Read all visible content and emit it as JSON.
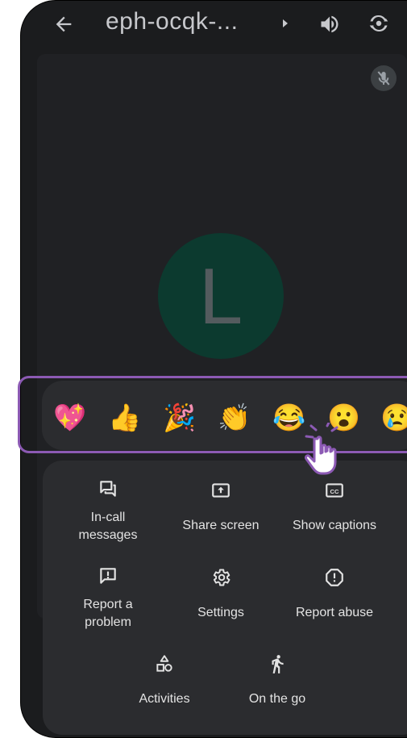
{
  "app": {
    "meeting_code": "eph-ocqk-...",
    "participant_initial": "L"
  },
  "reactions": {
    "items": [
      {
        "name": "sparkling-heart",
        "glyph": "💖"
      },
      {
        "name": "thumbs-up",
        "glyph": "👍"
      },
      {
        "name": "party-popper",
        "glyph": "🎉"
      },
      {
        "name": "clapping-hands",
        "glyph": "👏"
      },
      {
        "name": "tears-of-joy",
        "glyph": "😂"
      },
      {
        "name": "surprised-face",
        "glyph": "😮"
      },
      {
        "name": "crying-face",
        "glyph": "😢"
      }
    ]
  },
  "menu": {
    "in_call_messages": "In-call messages",
    "in_call_line1": "In-call",
    "in_call_line2": "messages",
    "share_screen": "Share screen",
    "show_captions": "Show captions",
    "report_problem_line1": "Report a",
    "report_problem_line2": "problem",
    "settings": "Settings",
    "report_abuse": "Report abuse",
    "activities": "Activities",
    "on_the_go": "On the go"
  },
  "colors": {
    "background": "#1b1c1e",
    "panel": "#2b2c2f",
    "avatar": "#0c3a2f",
    "highlight": "#8c5ab4",
    "text": "#e3e3e3"
  }
}
